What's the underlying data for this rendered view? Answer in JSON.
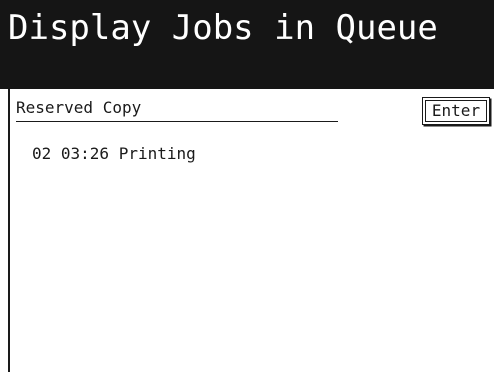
{
  "header": {
    "title": "Display Jobs in Queue"
  },
  "section": {
    "label": "Reserved Copy",
    "enter_label": "Enter"
  },
  "jobs": [
    {
      "text": "02 03:26 Printing"
    }
  ],
  "colors": {
    "title_bar_bg": "#151515",
    "title_text": "#ffffff",
    "body_bg": "#ffffff",
    "text": "#1a1a1a"
  }
}
